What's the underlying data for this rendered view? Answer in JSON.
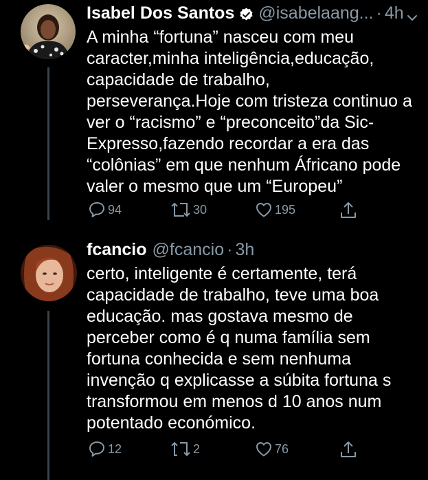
{
  "colors": {
    "background": "#000000",
    "text": "#ffffff",
    "secondary": "#8899a6",
    "verified": "#ffffff",
    "thread_line": "#3a444c"
  },
  "tweets": [
    {
      "display_name": "Isabel Dos Santos",
      "verified": true,
      "handle": "@isabelaang...",
      "separator": "·",
      "time": "4h",
      "text": "A minha “fortuna” nasceu com meu\ncaracter,minha inteligência,educação,\ncapacidade de trabalho,\nperseverança.Hoje com tristeza continuo a\nver o “racismo” e “preconceito”da Sic-\nExpresso,fazendo recordar a era das\n“colônias” em que nenhum Áfricano pode\nvaler o mesmo que um “Europeu”",
      "replies": "94",
      "retweets": "30",
      "likes": "195",
      "icons": [
        "reply-icon",
        "retweet-icon",
        "like-icon",
        "share-icon",
        "chevron-down-icon",
        "verified-badge-icon"
      ]
    },
    {
      "display_name": "fcancio",
      "verified": false,
      "handle": "@fcancio",
      "separator": "·",
      "time": "3h",
      "text": "certo, inteligente é certamente, terá\ncapacidade de trabalho, teve uma boa\neducação. mas gostava mesmo de\nperceber como é q numa família sem\nfortuna conhecida e sem nenhuma\ninvenção q explicasse a súbita fortuna s\ntransformou em menos d 10 anos num\npotentado económico.",
      "replies": "12",
      "retweets": "2",
      "likes": "76",
      "icons": [
        "reply-icon",
        "retweet-icon",
        "like-icon",
        "share-icon"
      ]
    }
  ]
}
